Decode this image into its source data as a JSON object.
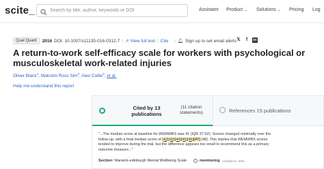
{
  "nav": {
    "logo": "scite_",
    "search_placeholder": "Search by title, author, keywords or DOI",
    "assistant": "Assistant",
    "product": "Product",
    "solutions": "Solutions",
    "pricing": "Pricing",
    "login": "Log"
  },
  "paper": {
    "badge": "Qual Quant",
    "year": "2016",
    "doi": "DOI: 10.1007/s11135-016-0312-7",
    "view_full_text": "View full text",
    "cite": "Cite",
    "sign_up": "Sign up to set email alerts",
    "title": "A return-to-work self-efficacy scale for workers with psychological or musculoskeletal work-related injuries",
    "authors": [
      {
        "name": "Oliver Black",
        "sup": "1"
      },
      {
        "name": "Malcolm Ross Sim",
        "sup": "2"
      },
      {
        "name": "Alex Collie",
        "sup": "3"
      }
    ],
    "et_al": "et al.",
    "help_link": "Help me understand this report"
  },
  "citations": {
    "cited_by": "Cited by 13 publications",
    "citation_statements": "(11 citation statements)",
    "references": "References 15 publications",
    "snippet_before": "\"...The median score at baseline for WEMWBS was 41 (IQR 37-52). Scores changed minimally over the follow-up, with a final median score of ",
    "snippet_refs": "[42][43][44][45][46]",
    "snippet_ref_bold": "[47]",
    "snippet_after": " [48]. This implies that WEMWBS scores tended to improve during the trial, but the difference appears too small to recommend this as a primary outcome measure...\"",
    "section_label": "Section:",
    "section_value": "Warwick-edinburgh Mental Wellbeing Scale",
    "mention_label": "mentioning",
    "confidence": "confidence: 99%"
  },
  "colors": {
    "accent": "#19a974",
    "link": "#2b64c6"
  }
}
